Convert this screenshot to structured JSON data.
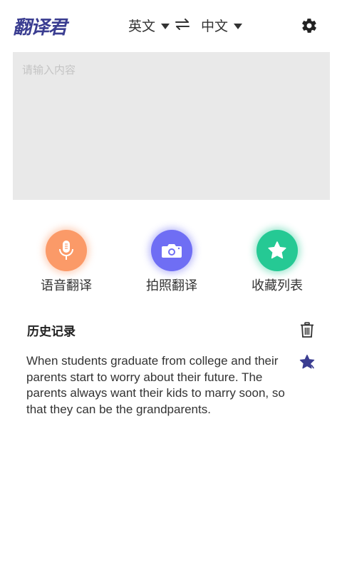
{
  "app": {
    "logo_text": "翻译君"
  },
  "header": {
    "source_lang": "英文",
    "target_lang": "中文",
    "swap_icon": "swap-arrows-icon",
    "settings_icon": "gear-icon"
  },
  "input": {
    "placeholder": "请输入内容",
    "value": ""
  },
  "actions": [
    {
      "label": "语音翻译",
      "icon": "microphone-icon",
      "color": "#fb9a68"
    },
    {
      "label": "拍照翻译",
      "icon": "camera-icon",
      "color": "#6f6ef4"
    },
    {
      "label": "收藏列表",
      "icon": "star-icon",
      "color": "#25c994"
    }
  ],
  "history": {
    "title": "历史记录",
    "delete_icon": "trash-icon",
    "items": [
      {
        "text": "When students graduate from college and their parents start to worry about their future. The parents always want their kids to marry soon, so that they can be the grandparents.",
        "favorited": true,
        "star_color": "#3a3d91"
      }
    ]
  },
  "colors": {
    "brand": "#3a3d91",
    "input_bg": "#e9e9e9"
  }
}
